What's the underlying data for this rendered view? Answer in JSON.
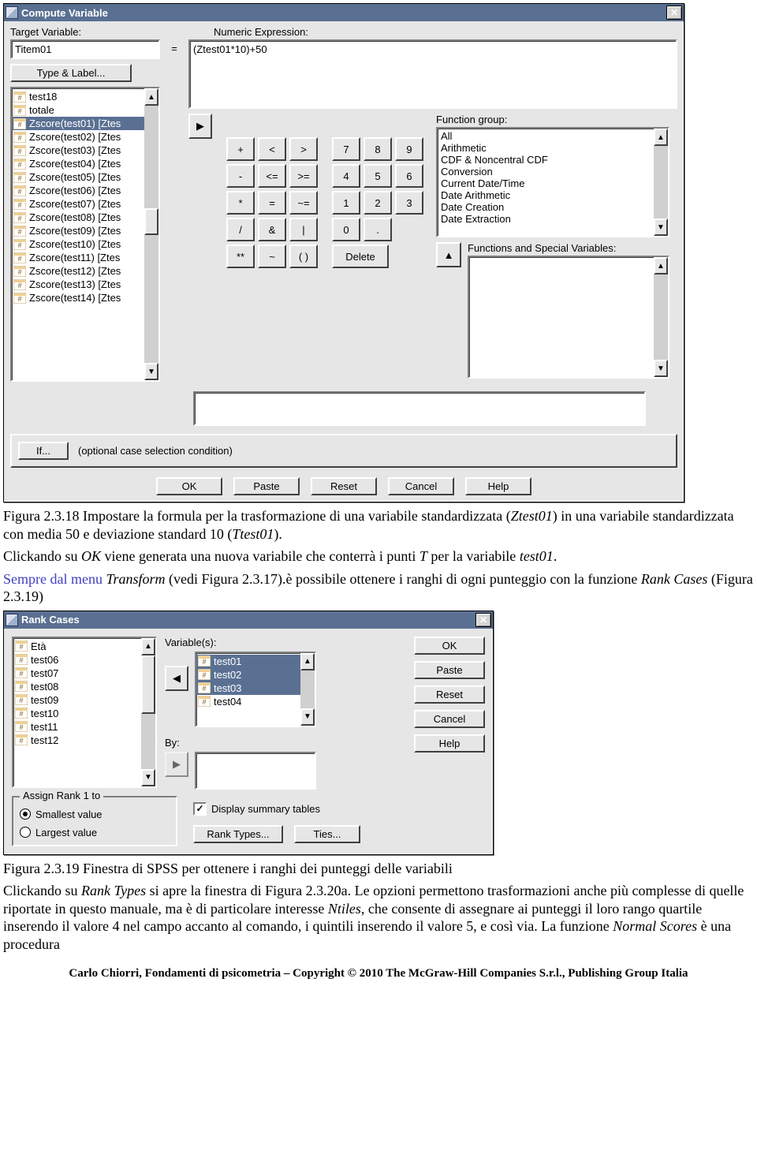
{
  "compute": {
    "title": "Compute Variable",
    "target_label": "Target Variable:",
    "target_value": "Titem01",
    "type_label_btn": "Type & Label...",
    "equals": "=",
    "expr_label": "Numeric Expression:",
    "expr_value": "(Ztest01*10)+50",
    "arrow_right": "▶",
    "var_list": [
      "test18",
      "totale",
      "Zscore(test01) [Ztes",
      "Zscore(test02) [Ztes",
      "Zscore(test03) [Ztes",
      "Zscore(test04) [Ztes",
      "Zscore(test05) [Ztes",
      "Zscore(test06) [Ztes",
      "Zscore(test07) [Ztes",
      "Zscore(test08) [Ztes",
      "Zscore(test09) [Ztes",
      "Zscore(test10) [Ztes",
      "Zscore(test11) [Ztes",
      "Zscore(test12) [Ztes",
      "Zscore(test13) [Ztes",
      "Zscore(test14) [Ztes"
    ],
    "selected_var_index": 2,
    "calc": {
      "r1": [
        "+",
        "<",
        ">",
        "7",
        "8",
        "9"
      ],
      "r2": [
        "-",
        "<=",
        ">=",
        "4",
        "5",
        "6"
      ],
      "r3": [
        "*",
        "=",
        "~=",
        "1",
        "2",
        "3"
      ],
      "r4": [
        "/",
        "&",
        "|",
        "0",
        "."
      ],
      "r5": [
        "**",
        "~",
        "( )",
        "Delete"
      ]
    },
    "func_group_label": "Function group:",
    "func_groups": [
      "All",
      "Arithmetic",
      "CDF & Noncentral CDF",
      "Conversion",
      "Current Date/Time",
      "Date Arithmetic",
      "Date Creation",
      "Date Extraction"
    ],
    "arrow_up": "▲",
    "funcs_label": "Functions and Special Variables:",
    "if_btn": "If...",
    "if_text": "(optional case selection condition)",
    "bottom_buttons": [
      "OK",
      "Paste",
      "Reset",
      "Cancel",
      "Help"
    ]
  },
  "para": {
    "cap1a": "Figura 2.3.18 Impostare la formula per la trasformazione di una variabile standardizzata (",
    "cap1b": "Ztest01",
    "cap1c": ") in una variabile standardizzata con media 50 e deviazione standard 10 (",
    "cap1d": "Ttest01",
    "cap1e": ").",
    "p2a": "Clickando su ",
    "p2b": "OK",
    "p2c": " viene generata una nuova variabile che conterrà i punti ",
    "p2d": "T",
    "p2e": " per la variabile ",
    "p2f": "test01",
    "p2g": ".",
    "p3a": "Sempre dal menu ",
    "p3b": "Transform",
    "p3c": " (vedi Figura 2.3.17).è possibile ottenere i ranghi di ogni punteggio con la funzione ",
    "p3d": "Rank Cases",
    "p3e": " (Figura 2.3.19)"
  },
  "rank": {
    "title": "Rank Cases",
    "left_items": [
      "Età",
      "test06",
      "test07",
      "test08",
      "test09",
      "test10",
      "test11",
      "test12"
    ],
    "var_label": "Variable(s):",
    "vars": [
      "test01",
      "test02",
      "test03",
      "test04"
    ],
    "selected_vars": [
      0,
      1,
      2
    ],
    "arrow_left": "◀",
    "arrow_right_disabled": "▶",
    "by_label": "By:",
    "buttons": [
      "OK",
      "Paste",
      "Reset",
      "Cancel",
      "Help"
    ],
    "group_title": "Assign Rank 1 to",
    "radio_small": "Smallest value",
    "radio_large": "Largest value",
    "display_summary": "Display summary tables",
    "rank_types_btn": "Rank Types...",
    "ties_btn": "Ties..."
  },
  "post": {
    "cap2": "Figura 2.3.19 Finestra di SPSS per ottenere i ranghi dei punteggi delle variabili",
    "p4a": "Clickando su ",
    "p4b": "Rank Types",
    "p4c": " si apre la finestra di Figura 2.3.20a. Le opzioni permettono trasformazioni anche più complesse di quelle riportate in questo manuale, ma è di particolare interesse ",
    "p4d": "Ntiles",
    "p4e": ", che consente di assegnare ai punteggi il loro rango quartile inserendo il valore 4 nel campo accanto al comando, i quintili inserendo il valore 5, e così via. La funzione ",
    "p4f": "Normal Scores",
    "p4g": " è una procedura"
  },
  "footer": "Carlo Chiorri, Fondamenti di psicometria – Copyright © 2010 The McGraw-Hill Companies S.r.l., Publishing Group Italia"
}
